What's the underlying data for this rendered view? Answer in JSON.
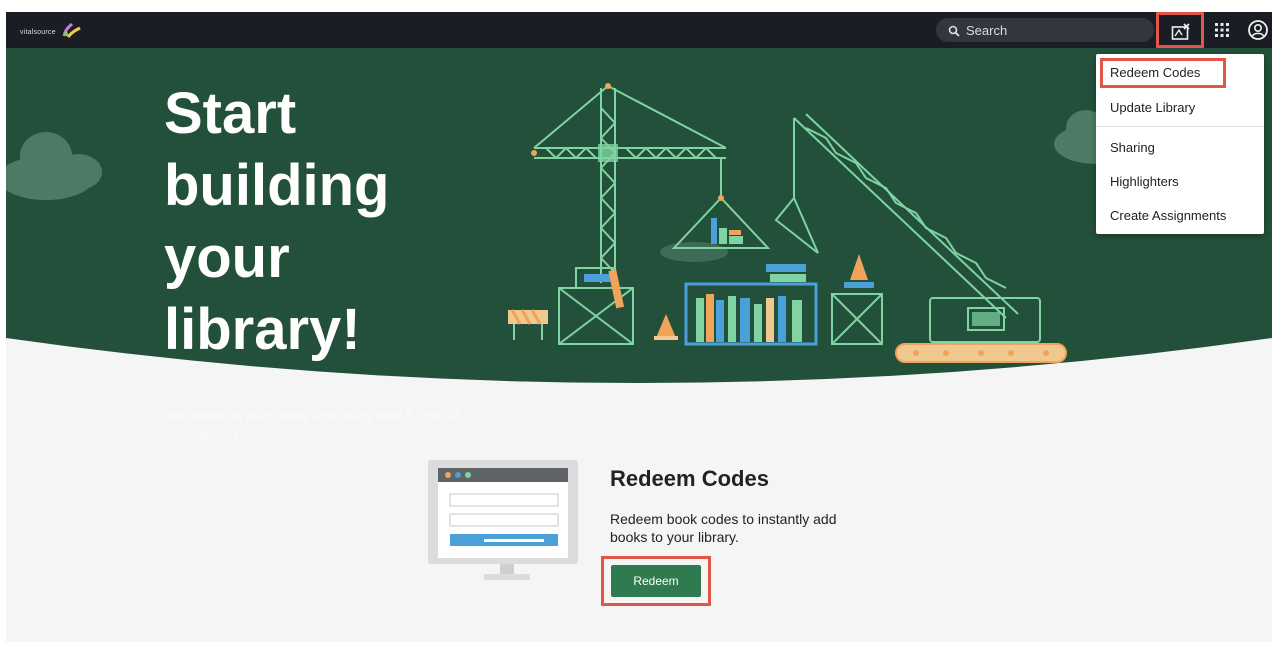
{
  "brand": {
    "logo_text": "vitalsource"
  },
  "header": {
    "search": {
      "placeholder": "Search"
    }
  },
  "menu": {
    "items": [
      "Redeem Codes",
      "Update Library",
      "Sharing",
      "Highlighters",
      "Create Assignments"
    ]
  },
  "hero": {
    "title": "Start building your library!",
    "subtitle": "Add books to your library and easily read & sync all your devices"
  },
  "redeem": {
    "title": "Redeem Codes",
    "description": "Redeem book codes to instantly add books to your library.",
    "button_label": "Redeem"
  },
  "colors": {
    "topbar": "#1a1d23",
    "hero_green": "#23503a",
    "accent_highlight": "#e2564a",
    "button_green": "#2f7a4f",
    "illustration_line": "#7fd4a2",
    "illustration_orange": "#f0a45a"
  },
  "icons": [
    "search-icon",
    "redeem-code-icon",
    "apps-grid-icon",
    "account-icon"
  ]
}
